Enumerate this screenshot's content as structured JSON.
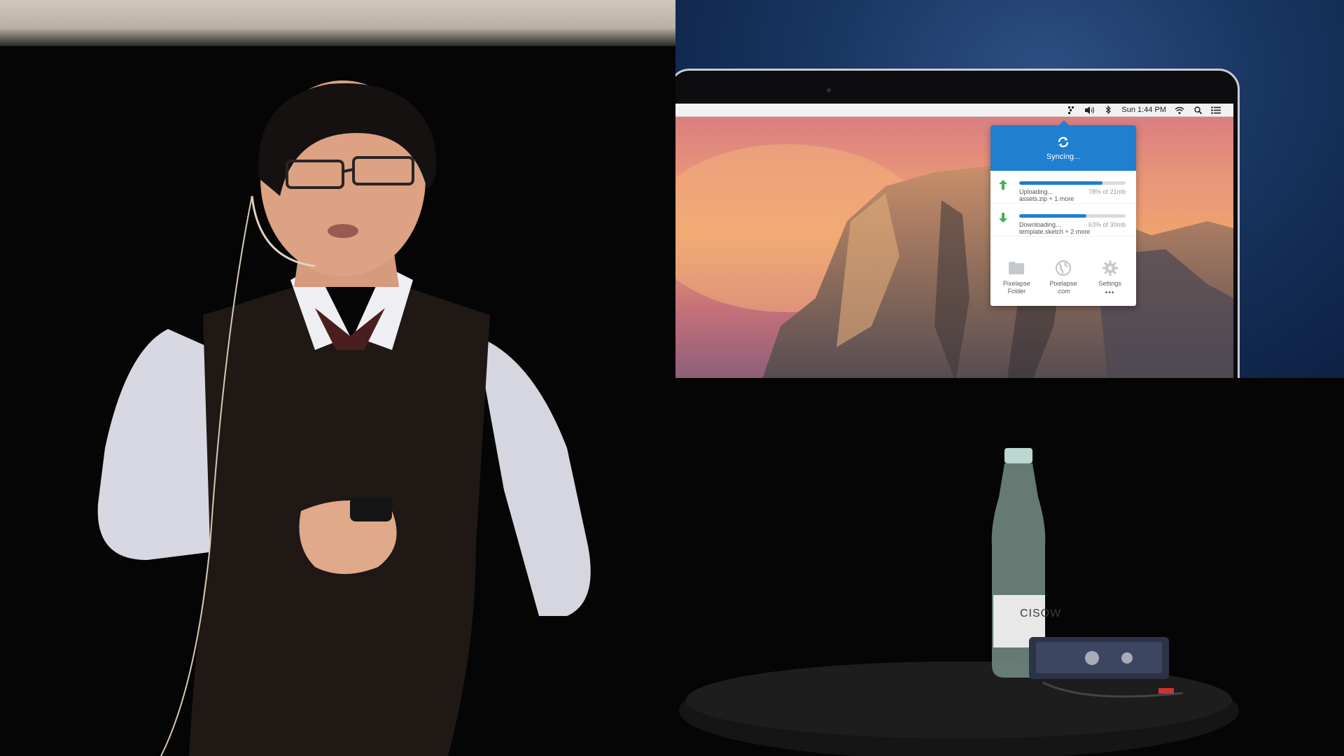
{
  "menubar": {
    "clock": "Sun 1:44 PM",
    "icons": [
      "pixelapse-menu-icon",
      "volume-icon",
      "bluetooth-icon",
      "wifi-icon",
      "spotlight-search-icon",
      "notification-center-icon"
    ]
  },
  "popover": {
    "status": "Syncing...",
    "upload": {
      "label": "Uploading...",
      "detail": "assets.zip + 1 more",
      "progress_text": "78% of 21mb",
      "progress": 0.78
    },
    "download": {
      "label": "Downloading...",
      "detail": "template.sketch + 2 more",
      "progress_text": "63% of 30mb",
      "progress": 0.63
    },
    "actions": [
      {
        "label": "Pixelapse\nFolder",
        "icon": "folder-icon"
      },
      {
        "label": "Pixelapse\n.com",
        "icon": "globe-icon"
      },
      {
        "label": "Settings",
        "icon": "gear-icon",
        "more": "•••"
      }
    ]
  },
  "bottle_label": "CISOW",
  "colors": {
    "accent": "#1f7fd0",
    "upload_arrow": "#3fb34f",
    "download_arrow": "#3fb34f"
  }
}
